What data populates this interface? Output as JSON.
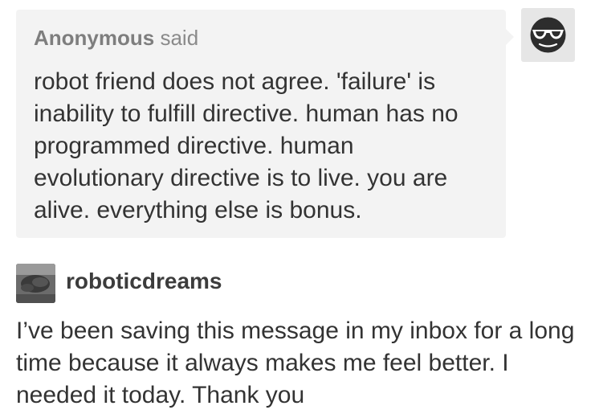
{
  "ask": {
    "asker_name": "Anonymous",
    "said_label": "said",
    "question": "robot friend does not agree. 'failure' is inability to fulfill directive. human has no programmed directive. human evolutionary directive is to live. you are alive. everything else is bonus.",
    "avatar_icon": "anonymous-sunglasses-icon"
  },
  "reply": {
    "username": "roboticdreams",
    "avatar_icon": "user-avatar-photo",
    "text": "I’ve been saving this message in my inbox for a long time because it always makes me feel better. I needed it today. Thank you"
  },
  "colors": {
    "bubble_background": "#f3f3f3",
    "text": "#333333",
    "meta_text": "#8a8a8a"
  }
}
